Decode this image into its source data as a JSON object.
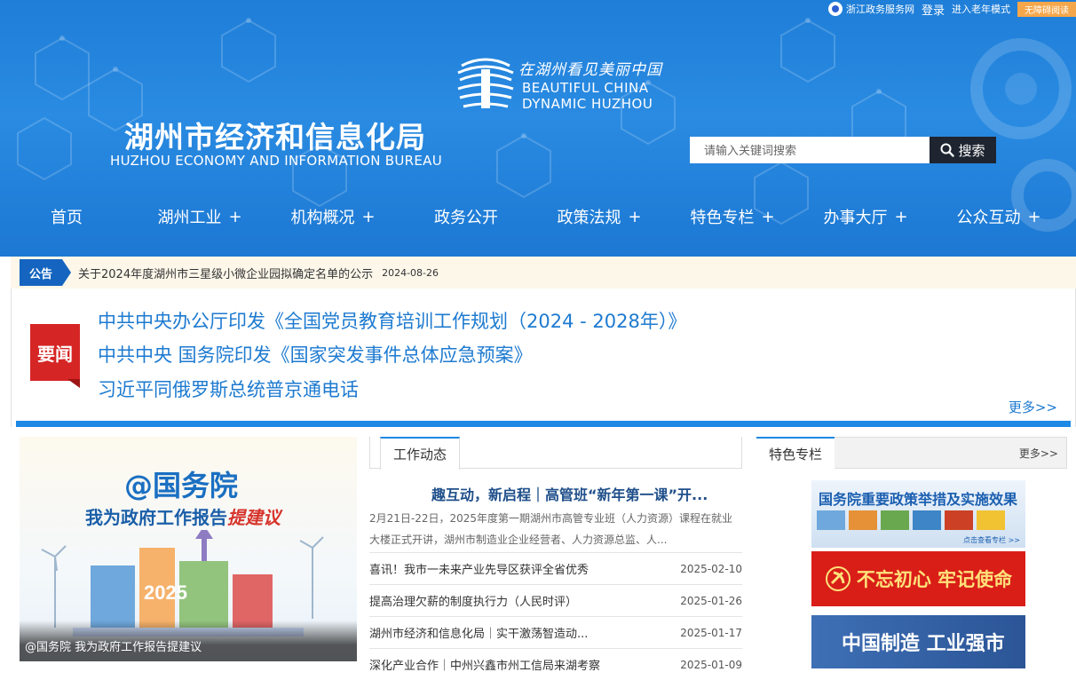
{
  "topbar": {
    "portal": "浙江政务服务网",
    "login": "登录",
    "elder_mode": "进入老年模式",
    "barrier_free": "无障碍阅读"
  },
  "slogan": {
    "cn": "在湖州看见美丽中国",
    "en_line1": "BEAUTIFUL CHINA",
    "en_line2": "DYNAMIC HUZHOU"
  },
  "site": {
    "name": "湖州市经济和信息化局",
    "name_en": "HUZHOU ECONOMY AND INFORMATION BUREAU"
  },
  "search": {
    "placeholder": "请输入关键词搜索",
    "button": "搜索"
  },
  "nav": [
    {
      "label": "首页",
      "has_sub": false
    },
    {
      "label": "湖州工业",
      "has_sub": true
    },
    {
      "label": "机构概况",
      "has_sub": true
    },
    {
      "label": "政务公开",
      "has_sub": false
    },
    {
      "label": "政策法规",
      "has_sub": true
    },
    {
      "label": "特色专栏",
      "has_sub": true
    },
    {
      "label": "办事大厅",
      "has_sub": true
    },
    {
      "label": "公众互动",
      "has_sub": true
    }
  ],
  "nav_plus": "+",
  "notice": {
    "tag": "公告",
    "text": "关于2024年度湖州市三星级小微企业园拟确定名单的公示",
    "date": "2024-08-26"
  },
  "headlines": {
    "tag": "要闻",
    "items": [
      "中共中央办公厅印发《全国党员教育培训工作规划（2024 - 2028年）》",
      "中共中央 国务院印发《国家突发事件总体应急预案》",
      "习近平同俄罗斯总统普京通电话"
    ],
    "more": "更多>>"
  },
  "banner": {
    "title": "@国务院",
    "subtitle": "我为政府工作报告",
    "subtitle_red": "提建议",
    "year": "2025",
    "caption": "@国务院 我为政府工作报告提建议"
  },
  "work": {
    "tab": "工作动态",
    "lead_title": "趣互动，新启程｜高管班“新年第一课”开...",
    "lead_summary": "2月21日-22日，2025年度第一期湖州市高管专业班（人力资源）课程在就业大楼正式开讲，湖州市制造业企业经营者、人力资源总监、人...",
    "rows": [
      {
        "title": "喜讯！我市一未来产业先导区获评全省优秀",
        "date": "2025-02-10"
      },
      {
        "title": "提高治理欠薪的制度执行力（人民时评）",
        "date": "2025-01-26"
      },
      {
        "title": "湖州市经济和信息化局｜实干激荡智造动...",
        "date": "2025-01-17"
      },
      {
        "title": "深化产业合作｜中州兴鑫市州工信局来湖考察",
        "date": "2025-01-09"
      }
    ]
  },
  "feature": {
    "tab": "特色专栏",
    "more": "更多>>",
    "banner1_title": "国务院重要政策举措及实施效果",
    "banner1_sub": "点击查看专栏 >>",
    "banner2_title": "不忘初心 牢记使命",
    "banner3_title": "中国制造 工业强市"
  },
  "colors": {
    "header_blue": "#1f7ed8",
    "link_blue": "#1d7ad0",
    "accent_red": "#d62525",
    "notice_bg": "#fdf7ea"
  }
}
